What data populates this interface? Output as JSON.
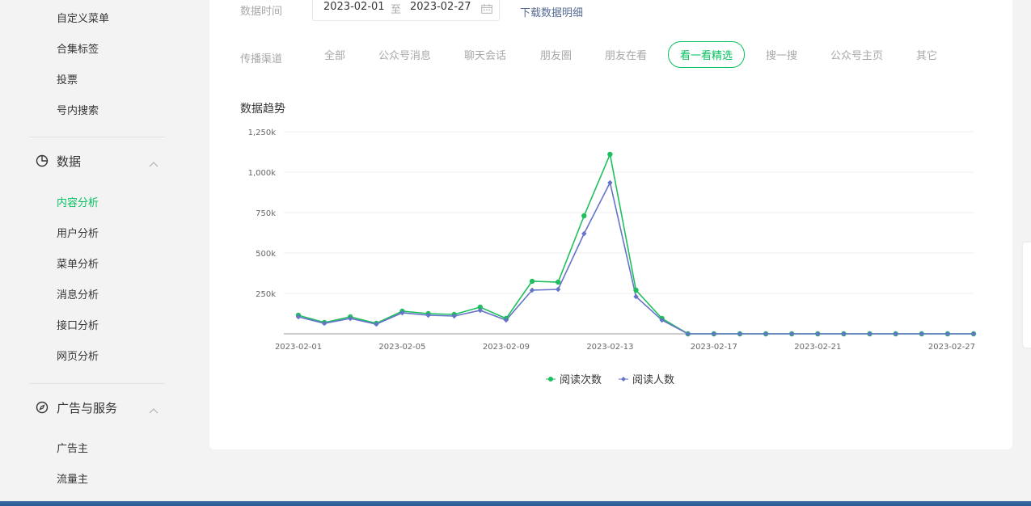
{
  "sidebar": {
    "items_top": [
      {
        "label": "自定义菜单"
      },
      {
        "label": "合集标签"
      },
      {
        "label": "投票"
      },
      {
        "label": "号内搜索"
      }
    ],
    "data_section": {
      "label": "数据",
      "icon": "pie-chart-icon",
      "items": [
        {
          "label": "内容分析",
          "active": true
        },
        {
          "label": "用户分析"
        },
        {
          "label": "菜单分析"
        },
        {
          "label": "消息分析"
        },
        {
          "label": "接口分析"
        },
        {
          "label": "网页分析"
        }
      ]
    },
    "ad_section": {
      "label": "广告与服务",
      "icon": "compass-icon",
      "items": [
        {
          "label": "广告主"
        },
        {
          "label": "流量主"
        }
      ]
    }
  },
  "filters": {
    "time_label": "数据时间",
    "start_date": "2023-02-01",
    "to_label": "至",
    "end_date": "2023-02-27",
    "download_label": "下载数据明细",
    "channel_label": "传播渠道",
    "channels": [
      "全部",
      "公众号消息",
      "聊天会话",
      "朋友圈",
      "朋友在看",
      "看一看精选",
      "搜一搜",
      "公众号主页",
      "其它"
    ],
    "active_channel": "看一看精选"
  },
  "chart_title": "数据趋势",
  "colors": {
    "accent": "#07c160",
    "series_reads": "#1fbf5f",
    "series_readers": "#6673c9",
    "link": "#576b95"
  },
  "chart_data": {
    "type": "line",
    "x": [
      "2023-02-01",
      "2023-02-02",
      "2023-02-03",
      "2023-02-04",
      "2023-02-05",
      "2023-02-06",
      "2023-02-07",
      "2023-02-08",
      "2023-02-09",
      "2023-02-10",
      "2023-02-11",
      "2023-02-12",
      "2023-02-13",
      "2023-02-14",
      "2023-02-15",
      "2023-02-16",
      "2023-02-17",
      "2023-02-18",
      "2023-02-19",
      "2023-02-20",
      "2023-02-21",
      "2023-02-22",
      "2023-02-23",
      "2023-02-24",
      "2023-02-25",
      "2023-02-26",
      "2023-02-27"
    ],
    "xticks": [
      "2023-02-01",
      "2023-02-05",
      "2023-02-09",
      "2023-02-13",
      "2023-02-17",
      "2023-02-21",
      "2023-02-27"
    ],
    "yticks": [
      "250k",
      "500k",
      "750k",
      "1,000k",
      "1,250k"
    ],
    "ytick_values": [
      250000,
      500000,
      750000,
      1000000,
      1250000
    ],
    "ylim": [
      0,
      1250000
    ],
    "series": [
      {
        "name": "阅读次数",
        "marker": "circle",
        "values": [
          115000,
          70000,
          105000,
          65000,
          140000,
          125000,
          120000,
          165000,
          95000,
          325000,
          320000,
          730000,
          1110000,
          270000,
          95000,
          0,
          0,
          0,
          0,
          0,
          0,
          0,
          0,
          0,
          0,
          0,
          0
        ]
      },
      {
        "name": "阅读人数",
        "marker": "diamond",
        "values": [
          105000,
          65000,
          95000,
          60000,
          130000,
          115000,
          110000,
          145000,
          85000,
          270000,
          275000,
          620000,
          935000,
          230000,
          85000,
          0,
          0,
          0,
          0,
          0,
          0,
          0,
          0,
          0,
          0,
          0,
          0
        ]
      }
    ],
    "grid": true,
    "legend_position": "bottom-center"
  }
}
